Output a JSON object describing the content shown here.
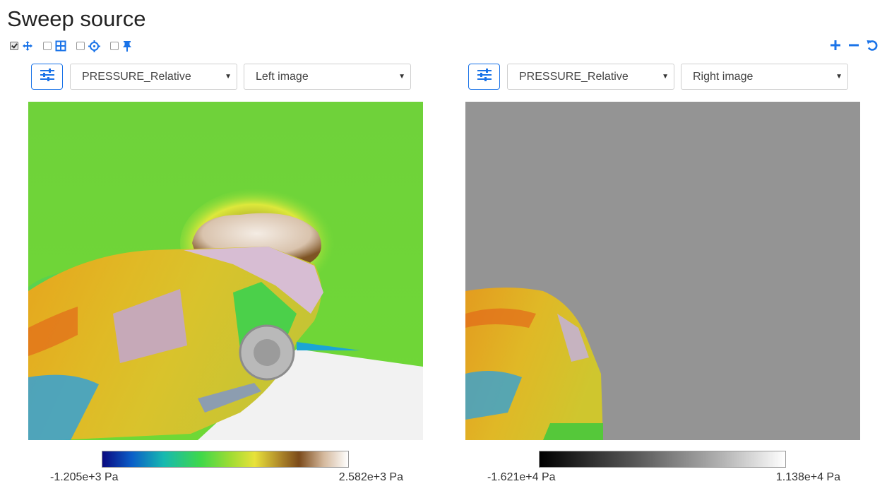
{
  "page": {
    "title": "Sweep source"
  },
  "toolbar": {
    "checkboxes": [
      {
        "name": "pan",
        "checked": true,
        "icon": "move-arrows-icon"
      },
      {
        "name": "grid",
        "checked": false,
        "icon": "grid-icon"
      },
      {
        "name": "crosshair",
        "checked": false,
        "icon": "crosshair-icon"
      },
      {
        "name": "pin",
        "checked": false,
        "icon": "pin-icon"
      }
    ],
    "right_icons": [
      "plus-icon",
      "minus-icon",
      "reset-icon"
    ]
  },
  "colors": {
    "accent": "#1a73e8"
  },
  "left_pane": {
    "field_select": "PRESSURE_Relative",
    "image_select": "Left image",
    "colorbar": {
      "colormap": "blue-teal-green-yellow-brown-white",
      "min_label": "-1.205e+3  Pa",
      "max_label": "2.582e+3  Pa"
    }
  },
  "right_pane": {
    "field_select": "PRESSURE_Relative",
    "image_select": "Right image",
    "colorbar": {
      "colormap": "black-to-white",
      "min_label": "-1.621e+4  Pa",
      "max_label": "1.138e+4  Pa"
    }
  }
}
